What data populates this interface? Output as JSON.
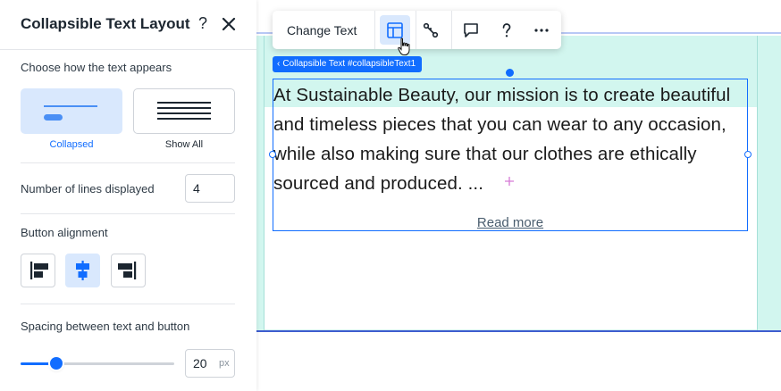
{
  "panel": {
    "title": "Collapsible Text Layout",
    "help_label": "?",
    "text_appearance": {
      "label": "Choose how the text appears",
      "options": [
        {
          "label": "Collapsed",
          "selected": true
        },
        {
          "label": "Show All",
          "selected": false
        }
      ]
    },
    "lines": {
      "label": "Number of lines displayed",
      "value": "4"
    },
    "button_alignment": {
      "label": "Button alignment",
      "options": [
        "align-left",
        "align-center",
        "align-right"
      ],
      "selected": "align-center"
    },
    "spacing": {
      "label": "Spacing between text and button",
      "value": "20",
      "unit": "px",
      "slider_fraction": 0.23
    }
  },
  "toolbar": {
    "change_text_label": "Change Text",
    "icons": [
      "layout-icon",
      "connect-icon",
      "comment-icon",
      "help-icon",
      "more-icon"
    ],
    "active_icon": "layout-icon"
  },
  "selection": {
    "tag_label": "Collapsible Text #collapsibleText1"
  },
  "content": {
    "paragraph": "At Sustainable Beauty, our mission is to create beautiful and timeless pieces that you can wear to any occasion, while also making sure that our clothes are ethically sourced and produced. ...",
    "read_more": "Read more"
  },
  "colors": {
    "accent": "#116dff",
    "accent_light": "#d9e8fd",
    "strip": "#d2f6ef"
  }
}
